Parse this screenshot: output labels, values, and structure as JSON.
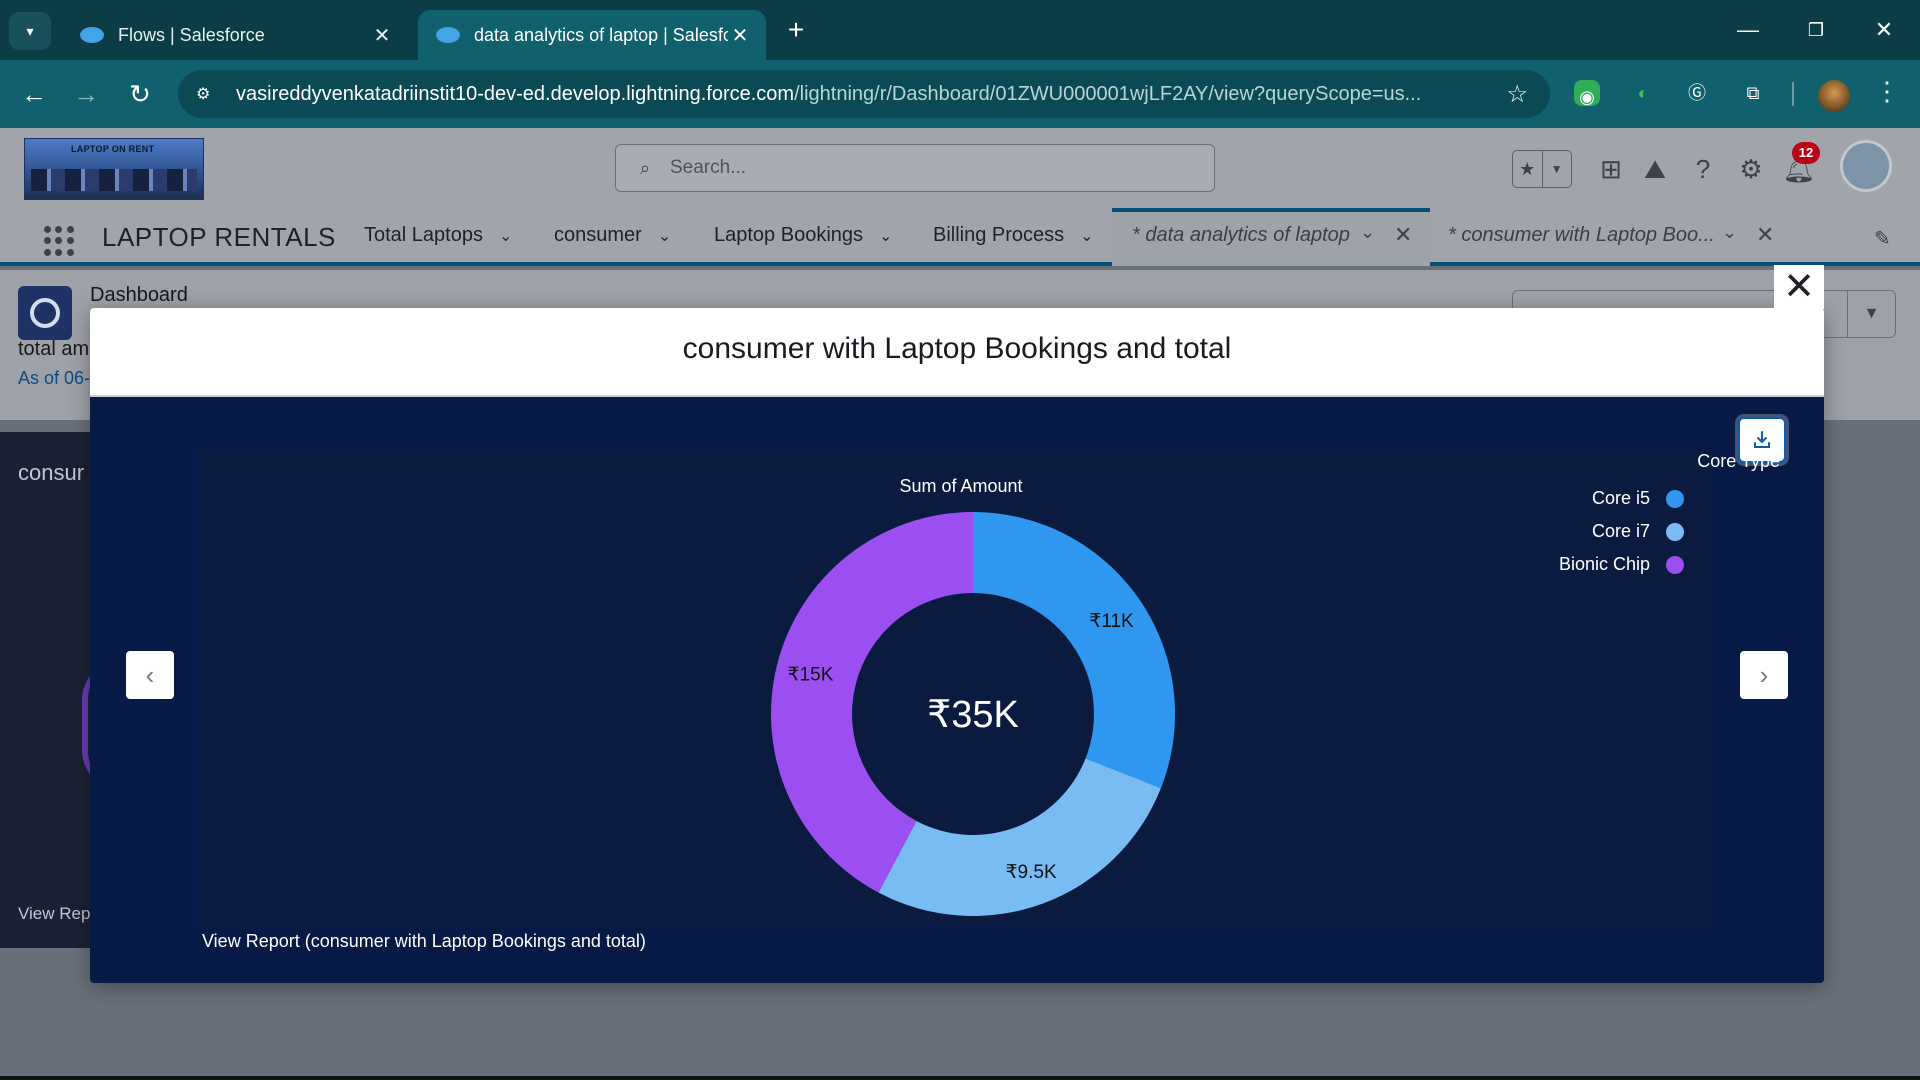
{
  "browser": {
    "tabs": [
      {
        "title": "Flows | Salesforce",
        "active": false
      },
      {
        "title": "data analytics of laptop | Salesforce",
        "active": true
      }
    ],
    "url_host": "vasireddyvenkatadriinstit10-dev-ed.develop.lightning.force.com",
    "url_path": "/lightning/r/Dashboard/01ZWU000001wjLF2AY/view?queryScope=us..."
  },
  "header": {
    "logo_text": "LAPTOP ON RENT",
    "search_placeholder": "Search...",
    "notification_count": "12"
  },
  "nav": {
    "app_name": "LAPTOP RENTALS",
    "items": [
      "Total Laptops",
      "consumer",
      "Laptop Bookings",
      "Billing Process"
    ],
    "open_tabs": [
      "* data analytics of laptop",
      "* consumer with Laptop Boo..."
    ]
  },
  "dashboard": {
    "type_label": "Dashboard",
    "name_partial": "total am",
    "as_of_partial": "As of 06-",
    "panel_title_partial": "consur",
    "view_partial": "View Rep"
  },
  "modal": {
    "title": "consumer with Laptop Bookings and total",
    "view_report": "View Report (consumer with Laptop Bookings and total)"
  },
  "chart_data": {
    "type": "pie",
    "variant": "donut",
    "title": "Sum of Amount",
    "center_label": "₹35K",
    "legend_title": "Core Type",
    "legend_position": "top-right",
    "series": [
      {
        "name": "Core i5",
        "value": 11000,
        "label": "₹11K",
        "color": "#2f97f0"
      },
      {
        "name": "Core i7",
        "value": 9500,
        "label": "₹9.5K",
        "color": "#79bcf4"
      },
      {
        "name": "Bionic Chip",
        "value": 15000,
        "label": "₹15K",
        "color": "#9b4ff0"
      }
    ]
  },
  "colors": {
    "browser_tabbar": "#0c3d46",
    "browser_toolbar": "#10606d",
    "modal_background": "#071a45",
    "chart_background": "#0b1a3f",
    "brand_blue": "#054f79"
  }
}
